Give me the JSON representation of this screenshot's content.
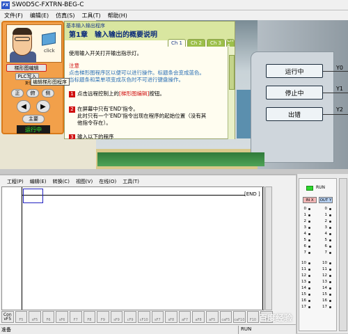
{
  "window": {
    "title": "SW0D5C-FXTRN-BEG-C",
    "icon": "fx-app-icon"
  },
  "menu": [
    "文件(F)",
    "编辑(E)",
    "仿真(S)",
    "工具(T)",
    "帮助(H)"
  ],
  "left_panel": {
    "click_text": "click",
    "ladder_btn": "梯形图编辑",
    "plc_btn": "PLC写入",
    "tooltip": "编辑梯形图程序",
    "obscured_btn": "复位",
    "view_btns": [
      "正",
      "俯",
      "侧"
    ],
    "prev_arrow": "◀",
    "next_arrow": "▶",
    "main_btn": "主要",
    "running": "运行中"
  },
  "lesson": {
    "subtitle": "基本输入输出程序",
    "title": "第1章　输入输出的概要说明",
    "tabs": [
      "Ch 1",
      "Ch 2",
      "Ch 3",
      "Ch 4"
    ],
    "intro": "使用输入开关打开输出指示灯。",
    "note_title": "注意",
    "note_lines": [
      "点击梯形图程序区以便可以进行操作。标题条会变成蓝色。",
      "当标题条和菜单项变成灰色时不可进行键盘操作。"
    ],
    "step1_num": "1",
    "step1_a": "点击远程控制上的",
    "step1_b": "[梯形图编辑]",
    "step1_c": "按钮。",
    "step2_num": "2",
    "step2_line1": "在屏幕中只有'END'指令。",
    "step2_line2": "此时只有一个'END'指令出现在程序的起始位置（没有其",
    "step2_line3": "他指令存在）。",
    "step3_num": "3",
    "step3_text": "输入以下的程序"
  },
  "status_buttons": {
    "run": "运行中",
    "stop": "停止中",
    "error": "出错"
  },
  "y_labels": [
    "Y0",
    "Y1",
    "Y2"
  ],
  "editor": {
    "menu": [
      "工程(P)",
      "编辑(E)",
      "转换(C)",
      "视图(V)",
      "在线(O)",
      "工具(T)"
    ],
    "end_label": "[END ]",
    "fkeys_first": [
      "Con",
      "vF5"
    ],
    "fkeys": [
      "F5",
      "sF5",
      "F6",
      "sF6",
      "F7",
      "F8",
      "F9",
      "sF9",
      "cF9",
      "cF10",
      "sF7",
      "sF8",
      "aF7",
      "aF8",
      "aF5",
      "caF5",
      "caF10",
      "F10",
      "aF9"
    ],
    "status_left": "准备",
    "status_mode": "RUN"
  },
  "io": {
    "run_label": "RUN",
    "in_label": "IN X",
    "out_label": "OUT Y",
    "in_numbers": [
      "0",
      "1",
      "2",
      "3",
      "4",
      "5",
      "6",
      "7",
      "10",
      "11",
      "12",
      "13",
      "14",
      "15",
      "16",
      "17"
    ],
    "out_numbers": [
      "0",
      "1",
      "2",
      "3",
      "4",
      "5",
      "6",
      "7",
      "10",
      "11",
      "12",
      "13",
      "14",
      "15",
      "16",
      "17"
    ]
  },
  "watermark": "百度经验",
  "colors": {
    "panel_orange": "#f2a04a",
    "lesson_green": "#d9e6a0",
    "running_green": "#2cf02c",
    "title_blue": "#0a2a7a"
  }
}
